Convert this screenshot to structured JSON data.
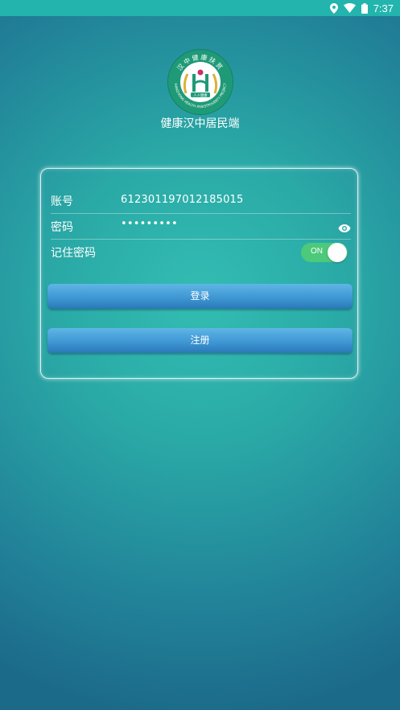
{
  "status_bar": {
    "time": "7:37",
    "icons": [
      "location-icon",
      "wifi-icon",
      "battery-icon"
    ]
  },
  "header": {
    "app_title": "健康汉中居民端",
    "logo": {
      "top_text": "汉中健康扶贫",
      "bottom_text": "HANZHONG HEALTH ASSISTPOVERTY PROJECT",
      "ribbon_text": "人人健康"
    }
  },
  "form": {
    "account_label": "账号",
    "account_value": "612301197012185015",
    "password_label": "密码",
    "password_value": "•••••••••",
    "remember_label": "记住密码",
    "remember_toggle": "ON",
    "login_button": "登录",
    "register_button": "注册"
  },
  "colors": {
    "background": "#2aa9a6",
    "toggle_on": "#4cc97a",
    "button": "#3f97d4"
  }
}
